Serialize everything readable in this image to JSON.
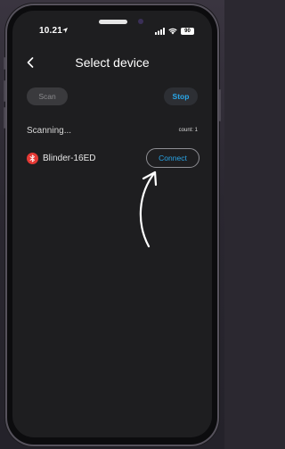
{
  "status_bar": {
    "time": "10.21",
    "battery": "90",
    "icons": [
      "location-arrow-icon",
      "signal-icon",
      "wifi-icon",
      "battery-icon"
    ]
  },
  "header": {
    "title": "Select device",
    "back_icon": "chevron-left-icon"
  },
  "controls": {
    "scan_label": "Scan",
    "stop_label": "Stop"
  },
  "scan_status": {
    "text": "Scanning...",
    "count": "count: 1"
  },
  "devices": [
    {
      "name": "Blinder-16ED",
      "icon": "bluetooth-icon",
      "action_label": "Connect"
    }
  ],
  "colors": {
    "accent": "#29a6e8",
    "bluetooth_badge": "#e53935",
    "screen_bg": "#1e1e20"
  },
  "annotation": {
    "icon": "hand-drawn-arrow-icon"
  }
}
